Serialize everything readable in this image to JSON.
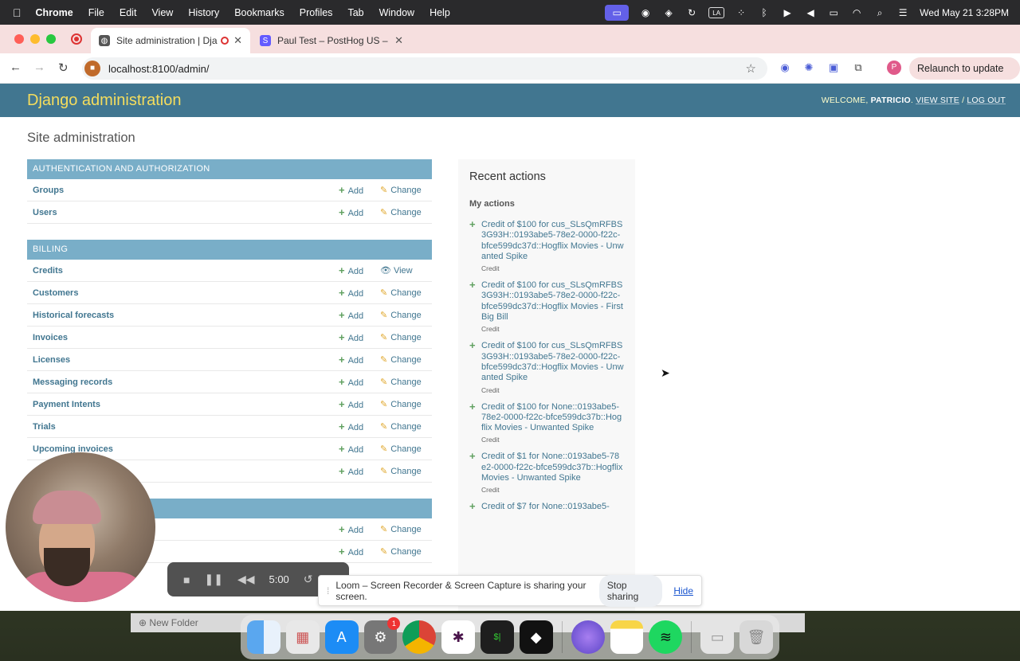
{
  "menubar": {
    "app": "Chrome",
    "items": [
      "File",
      "Edit",
      "View",
      "History",
      "Bookmarks",
      "Profiles",
      "Tab",
      "Window",
      "Help"
    ],
    "clock": "Wed May 21  3:28PM",
    "input_source": "LA"
  },
  "browser": {
    "tabs": [
      {
        "label": "Site administration | Djang"
      },
      {
        "label": "Paul Test – PostHog US – Stri"
      }
    ],
    "url": "localhost:8100/admin/",
    "profile_initial": "P",
    "relaunch_label": "Relaunch to update"
  },
  "header": {
    "branding": "Django administration",
    "welcome": "WELCOME,",
    "user": "PATRICIO",
    "view_site": "VIEW SITE",
    "separator": "/",
    "log_out": "LOG OUT"
  },
  "page_title": "Site administration",
  "modules": [
    {
      "caption": "Authentication and Authorization",
      "rows": [
        {
          "name": "Groups",
          "add": "Add",
          "second": "Change",
          "second_icon": "pencil"
        },
        {
          "name": "Users",
          "add": "Add",
          "second": "Change",
          "second_icon": "pencil"
        }
      ]
    },
    {
      "caption": "Billing",
      "rows": [
        {
          "name": "Credits",
          "add": "Add",
          "second": "View",
          "second_icon": "eye"
        },
        {
          "name": "Customers",
          "add": "Add",
          "second": "Change",
          "second_icon": "pencil"
        },
        {
          "name": "Historical forecasts",
          "add": "Add",
          "second": "Change",
          "second_icon": "pencil"
        },
        {
          "name": "Invoices",
          "add": "Add",
          "second": "Change",
          "second_icon": "pencil"
        },
        {
          "name": "Licenses",
          "add": "Add",
          "second": "Change",
          "second_icon": "pencil"
        },
        {
          "name": "Messaging records",
          "add": "Add",
          "second": "Change",
          "second_icon": "pencil"
        },
        {
          "name": "Payment Intents",
          "add": "Add",
          "second": "Change",
          "second_icon": "pencil"
        },
        {
          "name": "Trials",
          "add": "Add",
          "second": "Change",
          "second_icon": "pencil"
        },
        {
          "name": "Upcoming invoices",
          "add": "Add",
          "second": "Change",
          "second_icon": "pencil"
        },
        {
          "name": "",
          "add": "Add",
          "second": "Change",
          "second_icon": "pencil"
        }
      ]
    },
    {
      "caption": "",
      "rows": [
        {
          "name": "",
          "add": "Add",
          "second": "Change",
          "second_icon": "pencil"
        },
        {
          "name": "",
          "add": "Add",
          "second": "Change",
          "second_icon": "pencil"
        }
      ]
    }
  ],
  "recent_actions": {
    "title": "Recent actions",
    "subtitle": "My actions",
    "items": [
      {
        "text": "Credit of $100 for cus_SLsQmRFBS3G93H::0193abe5-78e2-0000-f22c-bfce599dc37d::Hogflix Movies - Unwanted Spike",
        "type": "Credit"
      },
      {
        "text": "Credit of $100 for cus_SLsQmRFBS3G93H::0193abe5-78e2-0000-f22c-bfce599dc37d::Hogflix Movies - First Big Bill",
        "type": "Credit"
      },
      {
        "text": "Credit of $100 for cus_SLsQmRFBS3G93H::0193abe5-78e2-0000-f22c-bfce599dc37d::Hogflix Movies - Unwanted Spike",
        "type": "Credit"
      },
      {
        "text": "Credit of $100 for None::0193abe5-78e2-0000-f22c-bfce599dc37b::Hogflix Movies - Unwanted Spike",
        "type": "Credit"
      },
      {
        "text": "Credit of $1 for None::0193abe5-78e2-0000-f22c-bfce599dc37b::Hogflix Movies - Unwanted Spike",
        "type": "Credit"
      },
      {
        "text": "Credit of $7 for None::0193abe5-",
        "type": ""
      }
    ]
  },
  "loom": {
    "timer": "5:00",
    "share_message": "Loom – Screen Recorder & Screen Capture is sharing your screen.",
    "stop_label": "Stop sharing",
    "hide_label": "Hide"
  },
  "finder": {
    "new_folder": "New Folder"
  },
  "dock": {
    "settings_badge": "1",
    "terminal_prompt": "$|",
    "apps": [
      "finder-icon",
      "launchpad-icon",
      "app-store-icon",
      "system-settings-icon",
      "chrome-icon",
      "slack-icon",
      "terminal-icon",
      "cursor-app-icon",
      "arc-app-icon",
      "notes-icon",
      "spotify-icon",
      "preview-icon",
      "trash-icon"
    ]
  },
  "colors": {
    "django_header": "#417690",
    "django_branding": "#f5dd5d",
    "module_caption": "#79aec8",
    "link": "#417690",
    "add_plus": "#5fa05f",
    "tab_strip": "#f6dfdf"
  }
}
